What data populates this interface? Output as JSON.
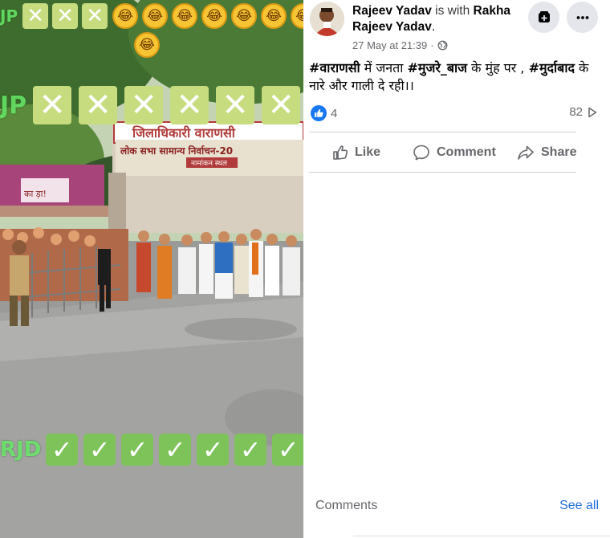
{
  "video": {
    "overlay_top_tag": "JP",
    "overlay_mid_tag": "JP",
    "overlay_bottom_tag": "RJD",
    "cross_mark": "✕",
    "check_mark": "✓",
    "laugh_emoji_glyph": "😂",
    "top_cross_count": 3,
    "top_laugh_count": 7,
    "mid_cross_count": 6,
    "bottom_check_count": 7,
    "banner_title": "जिलाधिकारी वाराणसी",
    "banner_subtitle": "लोक सभा सामान्य निर्वाचन-20",
    "banner_small": "नामांकन स्थल",
    "side_sign_text": "का ड़ा!"
  },
  "post": {
    "author_name": "Rajeev Yadav",
    "with_text": "is with",
    "tagged_name": "Rakha Rajeev Yadav",
    "tagged_suffix": ".",
    "timestamp": "27 May at 21:39",
    "audience_icon": "globe-icon",
    "text_segments": [
      {
        "text": "#वाराणसी",
        "hashtag": true
      },
      {
        "text": " में जनता ",
        "hashtag": false
      },
      {
        "text": "#मुजरे_बाज",
        "hashtag": true
      },
      {
        "text": " के मुंह पर , ",
        "hashtag": false
      },
      {
        "text": "#मुर्दाबाद",
        "hashtag": true
      },
      {
        "text": " के नारे और गाली दे रही।।",
        "hashtag": false
      }
    ],
    "reaction_icon": "like-reaction-icon",
    "reaction_count": "4",
    "view_count": "82",
    "like_label": "Like",
    "comment_label": "Comment",
    "share_label": "Share",
    "comments_heading": "Comments",
    "see_all_label": "See all"
  },
  "colors": {
    "link_blue": "#216fdb",
    "secondary_text": "#65676b",
    "reaction_blue": "#1877f2",
    "cross_box": "#c7dc7f",
    "check_box": "#7dc35a",
    "banner_red": "#c0392b"
  }
}
